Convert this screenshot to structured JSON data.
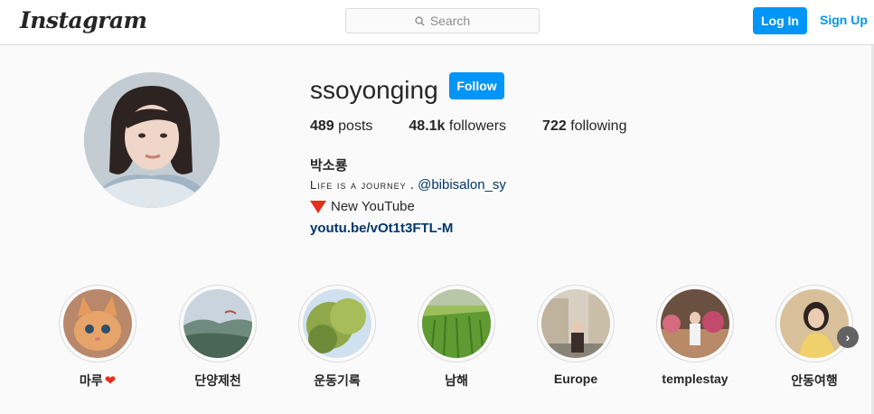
{
  "header": {
    "logo_text": "Instagram",
    "search_placeholder": "Search",
    "login_label": "Log In",
    "signup_label": "Sign Up"
  },
  "profile": {
    "username": "ssoyonging",
    "follow_label": "Follow",
    "posts_count": "489",
    "posts_label": "posts",
    "followers_count": "48.1k",
    "followers_label": "followers",
    "following_count": "722",
    "following_label": "following",
    "full_name": "박소룡",
    "bio_caps": "Life is a journey",
    "bio_sep": " . ",
    "bio_mention": "@bibisalon_sy",
    "bio_line2": "New YouTube",
    "bio_link": "youtu.be/vOt1t3FTL-M"
  },
  "highlights": [
    {
      "label": "마루"
    },
    {
      "label": "단양제천"
    },
    {
      "label": "운동기록"
    },
    {
      "label": "남해"
    },
    {
      "label": "Europe"
    },
    {
      "label": "templestay"
    },
    {
      "label": "안동여행"
    }
  ],
  "colors": {
    "accent": "#0095f6",
    "link": "#00376b",
    "background": "#fafafa"
  }
}
